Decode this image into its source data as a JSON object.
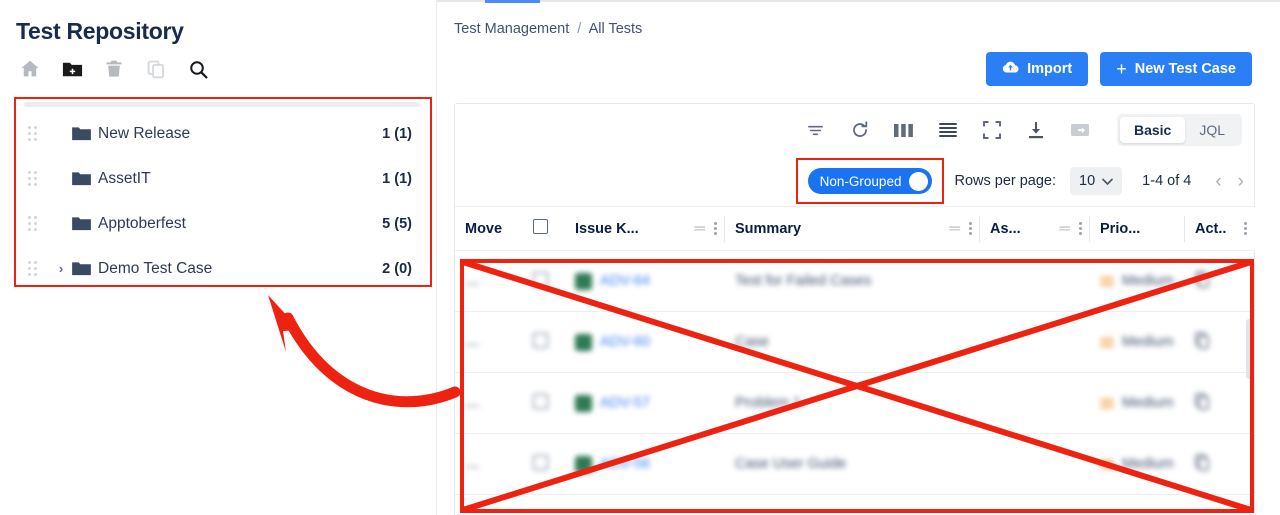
{
  "sidebar": {
    "title": "Test Repository",
    "tools": [
      {
        "name": "home-icon",
        "label": "Home"
      },
      {
        "name": "new-folder-icon",
        "label": "New Folder"
      },
      {
        "name": "trash-icon",
        "label": "Delete"
      },
      {
        "name": "copy-icon",
        "label": "Copy"
      },
      {
        "name": "search-icon",
        "label": "Search"
      }
    ],
    "tree": [
      {
        "label": "New Release",
        "count": "1 (1)",
        "expandable": false
      },
      {
        "label": "AssetIT",
        "count": "1 (1)",
        "expandable": false
      },
      {
        "label": "Apptoberfest",
        "count": "5 (5)",
        "expandable": false
      },
      {
        "label": "Demo Test Case",
        "count": "2 (0)",
        "expandable": true
      }
    ]
  },
  "breadcrumb": {
    "parent": "Test Management",
    "separator": "/",
    "current": "All Tests"
  },
  "header": {
    "import_label": "Import",
    "new_test_case_label": "New Test Case",
    "plus": "+"
  },
  "toolbar": {
    "icons": [
      {
        "name": "filter-icon"
      },
      {
        "name": "refresh-icon"
      },
      {
        "name": "columns-icon"
      },
      {
        "name": "density-icon"
      },
      {
        "name": "fullscreen-icon"
      },
      {
        "name": "download-icon"
      },
      {
        "name": "export-folder-icon"
      }
    ],
    "mode_basic": "Basic",
    "mode_jql": "JQL"
  },
  "controls": {
    "group_toggle_label": "Non-Grouped",
    "rows_per_page_label": "Rows per page:",
    "rows_per_page_value": "10",
    "range_label": "1-4 of 4",
    "prev": "‹",
    "next": "›"
  },
  "table": {
    "columns": [
      "Move",
      "",
      "Issue K...",
      "Summary",
      "As...",
      "Prio...",
      "Act.."
    ],
    "rows": [
      {
        "key": "ADV-64",
        "summary": "Test for Failed Cases",
        "assignee": "",
        "priority": "Medium"
      },
      {
        "key": "ADV-60",
        "summary": "Case",
        "assignee": "",
        "priority": "Medium"
      },
      {
        "key": "ADV-57",
        "summary": "Problem 1",
        "assignee": "",
        "priority": "Medium"
      },
      {
        "key": "ADV-56",
        "summary": "Case User Guide",
        "assignee": "",
        "priority": "Medium"
      }
    ]
  },
  "annotations": {
    "highlight_color": "#ee2211",
    "shapes": [
      "tree-highlight-box",
      "group-toggle-highlight-box",
      "table-crossed-out",
      "arrow-to-tree"
    ]
  },
  "colors": {
    "accent_blue": "#2b7ff5",
    "title_navy": "#172b4d",
    "annotation_red": "#ee2211",
    "priority_orange": "#f7a85c"
  }
}
